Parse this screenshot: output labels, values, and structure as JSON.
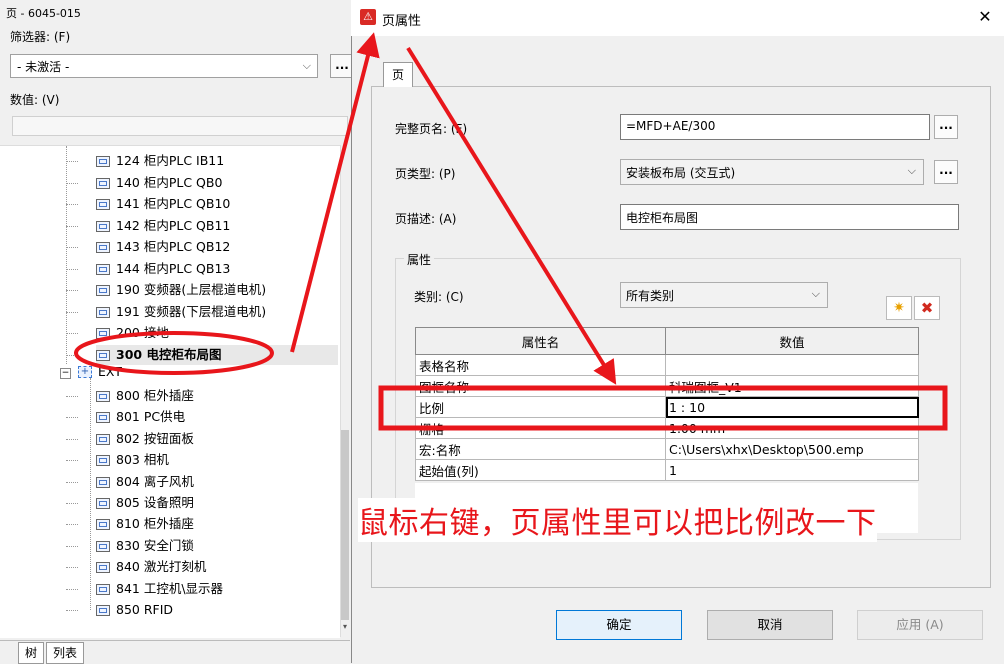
{
  "left_panel": {
    "title": "页 - 6045-015",
    "filter_label": "筛选器: (F)",
    "filter_value": "- 未激活 -",
    "filter_button": "...",
    "value_label": "数值: (V)",
    "value_text": "",
    "tree_items": [
      {
        "label": "124 柜内PLC IB11"
      },
      {
        "label": "140 柜内PLC QB0"
      },
      {
        "label": "141 柜内PLC QB10"
      },
      {
        "label": "142 柜内PLC QB11"
      },
      {
        "label": "143 柜内PLC QB12"
      },
      {
        "label": "144 柜内PLC QB13"
      },
      {
        "label": "190 变频器(上层棍道电机)"
      },
      {
        "label": "191 变频器(下层棍道电机)"
      },
      {
        "label": "200 接地"
      },
      {
        "label": "300 电控柜布局图",
        "selected": true
      }
    ],
    "group_node": {
      "label": "EXT",
      "expander": "−",
      "icon": "+"
    },
    "ext_items": [
      {
        "label": "800 柜外插座"
      },
      {
        "label": "801 PC供电"
      },
      {
        "label": "802 按钮面板"
      },
      {
        "label": "803 相机"
      },
      {
        "label": "804 离子风机"
      },
      {
        "label": "805 设备照明"
      },
      {
        "label": "810 柜外插座"
      },
      {
        "label": "830 安全门锁"
      },
      {
        "label": "840 激光打刻机"
      },
      {
        "label": "841 工控机\\显示器"
      },
      {
        "label": "850 RFID"
      }
    ],
    "tabs": [
      "树",
      "列表"
    ]
  },
  "dialog": {
    "title": "页属性",
    "app_icon": "eplan-logo-icon",
    "close_glyph": "✕",
    "tab": "页",
    "full_page_name_label": "完整页名: (F)",
    "full_page_name_value": "=MFD+AE/300",
    "page_type_label": "页类型: (P)",
    "page_type_value": "安装板布局 (交互式)",
    "page_desc_label": "页描述: (A)",
    "page_desc_value": "电控柜布局图",
    "dots": "...",
    "group_title": "属性",
    "category_label": "类别: (C)",
    "category_value": "所有类别",
    "new_glyph": "✷",
    "delete_glyph": "✖",
    "table": {
      "headers": [
        "属性名",
        "数值"
      ],
      "rows": [
        [
          "表格名称",
          ""
        ],
        [
          "图框名称",
          "科瑞图框_V1"
        ],
        [
          "比例",
          "1 : 10"
        ],
        [
          "栅格",
          "1.00 mm"
        ],
        [
          "宏:名称",
          "C:\\Users\\xhx\\Desktop\\500.emp"
        ],
        [
          "起始值(列)",
          "1"
        ]
      ]
    },
    "buttons": {
      "ok": "确定",
      "cancel": "取消",
      "apply": "应用 (A)"
    }
  },
  "annotation": {
    "text": "鼠标右键，页属性里可以把比例改一下",
    "color": "#e8161b"
  }
}
